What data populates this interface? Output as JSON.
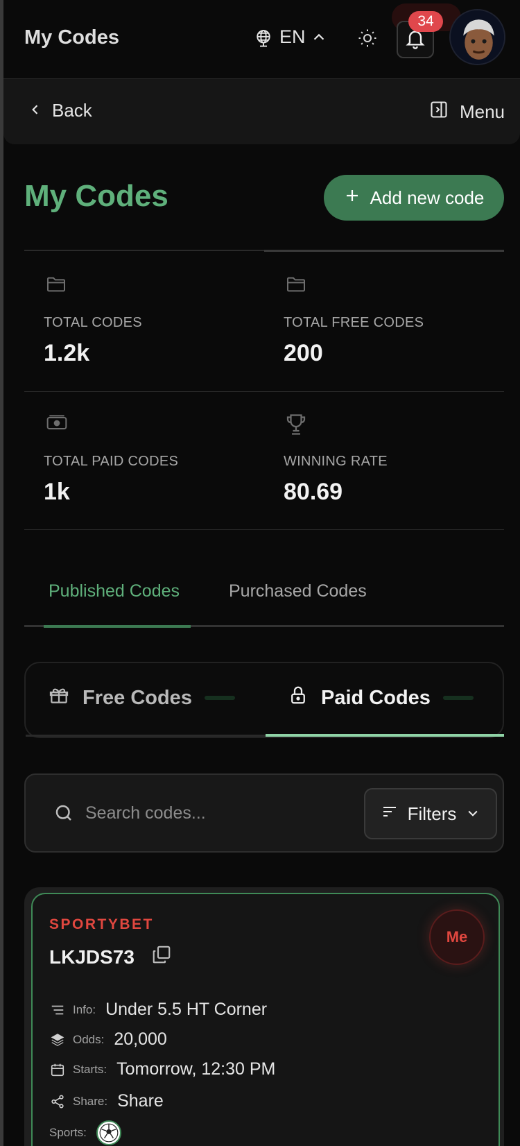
{
  "header": {
    "title": "My Codes",
    "language": "EN",
    "notifications_count": "34"
  },
  "nav": {
    "back_label": "Back",
    "menu_label": "Menu"
  },
  "page": {
    "title": "My Codes",
    "add_button_label": "Add new code"
  },
  "stats": [
    {
      "label": "TOTAL CODES",
      "value": "1.2k",
      "icon": "folder-icon"
    },
    {
      "label": "TOTAL FREE CODES",
      "value": "200",
      "icon": "folder-icon"
    },
    {
      "label": "TOTAL PAID CODES",
      "value": "1k",
      "icon": "banknote-icon"
    },
    {
      "label": "WINNING RATE",
      "value": "80.69",
      "icon": "trophy-icon"
    }
  ],
  "tabs": {
    "published": "Published Codes",
    "purchased": "Purchased Codes",
    "active": "published"
  },
  "segment": {
    "free": "Free Codes",
    "paid": "Paid Codes",
    "active": "paid"
  },
  "search": {
    "placeholder": "Search codes...",
    "value": "",
    "filters_label": "Filters"
  },
  "card": {
    "bookmaker": "SPORTYBET",
    "code": "LKJDS73",
    "owner_badge": "Me",
    "info_label": "Info:",
    "info_value": "Under 5.5 HT Corner",
    "odds_label": "Odds:",
    "odds_value": "20,000",
    "starts_label": "Starts:",
    "starts_value": "Tomorrow, 12:30 PM",
    "share_label": "Share:",
    "share_value": "Share",
    "sports_label": "Sports:",
    "sports_icon": "soccer-ball-icon"
  },
  "colors": {
    "accent_green": "#5fb07b",
    "button_green": "#3c7a52",
    "bookmaker_red": "#e0473f",
    "badge_red": "#e0474c"
  }
}
